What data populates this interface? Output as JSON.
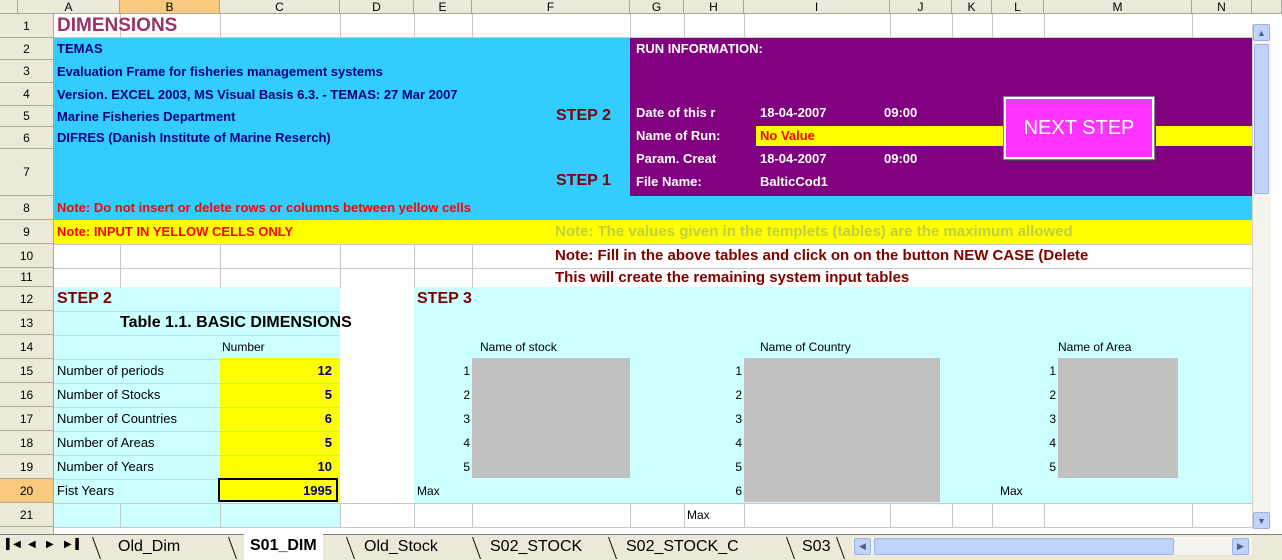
{
  "columns": [
    "A",
    "B",
    "C",
    "D",
    "E",
    "F",
    "G",
    "H",
    "I",
    "J",
    "K",
    "L",
    "M",
    "N"
  ],
  "rows": [
    "1",
    "2",
    "3",
    "4",
    "5",
    "6",
    "7",
    "8",
    "9",
    "10",
    "11",
    "12",
    "13",
    "14",
    "15",
    "16",
    "17",
    "18",
    "19",
    "20",
    "21"
  ],
  "header": {
    "title": "DIMENSIONS",
    "temas": "TEMAS",
    "eval_frame": "Evaluation Frame for fisheries management systems",
    "version": "Version. EXCEL 2003, MS Visual Basis 6.3. - TEMAS: 27 Mar 2007",
    "dept": "Marine Fisheries Department",
    "difres": "DIFRES (Danish Institute of Marine Reserch)",
    "step2_small": "STEP 2",
    "step1_small": "STEP 1"
  },
  "run_info": {
    "heading": "RUN INFORMATION:",
    "date_label": "Date of this r",
    "date_value": "18-04-2007",
    "date_time": "09:00",
    "name_label": "Name of Run:",
    "name_value": "No Value",
    "param_label": "Param. Creat",
    "param_value": "18-04-2007",
    "param_time": "09:00",
    "file_label": "File Name:",
    "file_value": "BalticCod1"
  },
  "next_step_label": "NEXT STEP",
  "notes": {
    "note8": "Note: Do not insert or delete rows or columns between yellow cells",
    "note9": "Note: INPUT IN YELLOW CELLS ONLY",
    "note9b": "Note: The values given in the templets (tables) are the maximum allowed",
    "note10": "Note: Fill in the above tables and click on on the button NEW CASE (Delete",
    "note11": "This will create the remaining system input tables"
  },
  "step2": {
    "label": "STEP 2",
    "table_title": "Table 1.1.  BASIC DIMENSIONS",
    "number_header": "Number",
    "items": [
      {
        "label": "Number of periods",
        "value": "12"
      },
      {
        "label": "Number of Stocks",
        "value": "5"
      },
      {
        "label": "Number of Countries",
        "value": "6"
      },
      {
        "label": "Number of Areas",
        "value": "5"
      },
      {
        "label": "Number of Years",
        "value": "10"
      },
      {
        "label": "Fist Years",
        "value": "1995"
      }
    ]
  },
  "step3": {
    "label": "STEP 3",
    "stock_header": "Name of stock",
    "country_header": "Name of Country",
    "area_header": "Name of Area",
    "stock_idx": [
      "1",
      "2",
      "3",
      "4",
      "5"
    ],
    "country_idx": [
      "1",
      "2",
      "3",
      "4",
      "5",
      "6"
    ],
    "area_idx": [
      "1",
      "2",
      "3",
      "4",
      "5"
    ],
    "max_label": "Max"
  },
  "tabs": [
    "Old_Dim",
    "S01_DIM",
    "Old_Stock",
    "S02_STOCK",
    "S02_STOCK_C",
    "S03"
  ],
  "active_tab": "S01_DIM",
  "colors": {
    "cyan": "#33ccff",
    "purple": "#800080",
    "yellow": "#ffff00",
    "lightcyan": "#ccffff",
    "gray": "#c0c0c0",
    "darkred": "#800000",
    "magenta": "#ff33ff"
  }
}
